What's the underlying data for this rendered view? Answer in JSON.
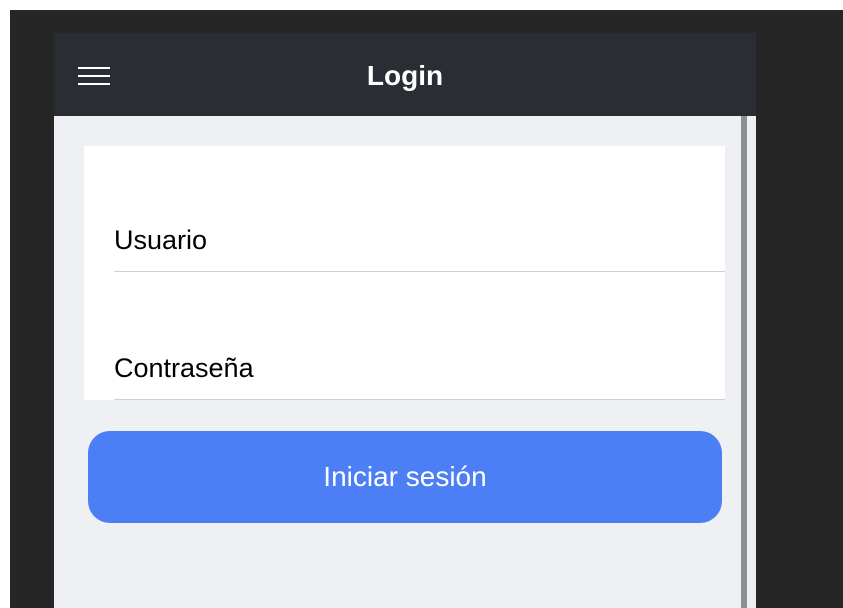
{
  "header": {
    "title": "Login",
    "menu_icon": "hamburger-menu-icon"
  },
  "form": {
    "username": {
      "placeholder": "Usuario",
      "value": ""
    },
    "password": {
      "placeholder": "Contraseña",
      "value": ""
    }
  },
  "actions": {
    "login_label": "Iniciar sesión"
  },
  "colors": {
    "header_bg": "#2a2d34",
    "content_bg": "#eff0f4",
    "button_bg": "#4c7ff5",
    "outer_bg": "#262626"
  }
}
